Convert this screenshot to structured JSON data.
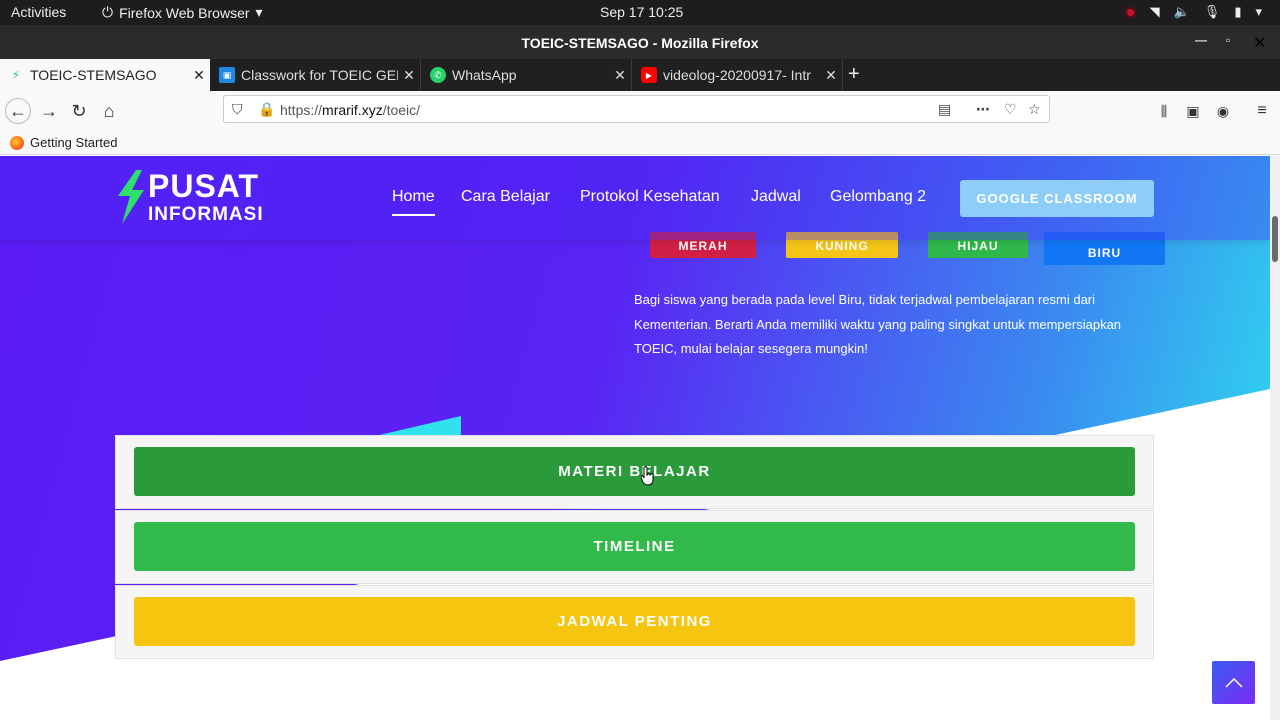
{
  "topbar": {
    "activities": "Activities",
    "app": "Firefox Web Browser",
    "clock": "Sep 17  10:25"
  },
  "window": {
    "title": "TOEIC-STEMSAGO - Mozilla Firefox"
  },
  "tabs": [
    {
      "label": "TOEIC-STEMSAGO",
      "icon": "stemsago-favicon"
    },
    {
      "label": "Classwork for TOEIC GEL",
      "icon": "classroom-favicon"
    },
    {
      "label": "WhatsApp",
      "icon": "whatsapp-favicon"
    },
    {
      "label": "videolog-20200917- Intr",
      "icon": "youtube-favicon"
    }
  ],
  "url": {
    "prefix": "https://",
    "domain": "mrarif.xyz",
    "path": "/toeic/"
  },
  "bookmarks": [
    {
      "label": "Getting Started"
    }
  ],
  "site": {
    "logo": {
      "line1": "PUSAT",
      "line2": "INFORMASI"
    },
    "nav": [
      {
        "label": "Home"
      },
      {
        "label": "Cara Belajar"
      },
      {
        "label": "Protokol Kesehatan"
      },
      {
        "label": "Jadwal"
      },
      {
        "label": "Gelombang 2"
      }
    ],
    "cta": "GOOGLE CLASSROOM",
    "levels": [
      {
        "label": "MERAH",
        "color": "#d11f45"
      },
      {
        "label": "KUNING",
        "color": "#f5c518"
      },
      {
        "label": "HIJAU",
        "color": "#2fb84a"
      },
      {
        "label": "BIRU",
        "color": "#1177f5"
      }
    ],
    "description": "Bagi siswa yang berada pada level Biru, tidak terjadwal pembelajaran resmi dari Kementerian. Berarti Anda memiliki waktu yang paling singkat untuk mempersiapkan TOEIC, mulai belajar sesegera mungkin!",
    "accordion": [
      {
        "label": "MATERI BELAJAR",
        "color": "#2a9a3a"
      },
      {
        "label": "TIMELINE",
        "color": "#31b94a"
      },
      {
        "label": "JADWAL PENTING",
        "color": "#f5c510"
      }
    ]
  },
  "colors": {
    "hero_start": "#5b1cf5",
    "hero_end": "#2de6ee",
    "accent": "#e95420"
  }
}
